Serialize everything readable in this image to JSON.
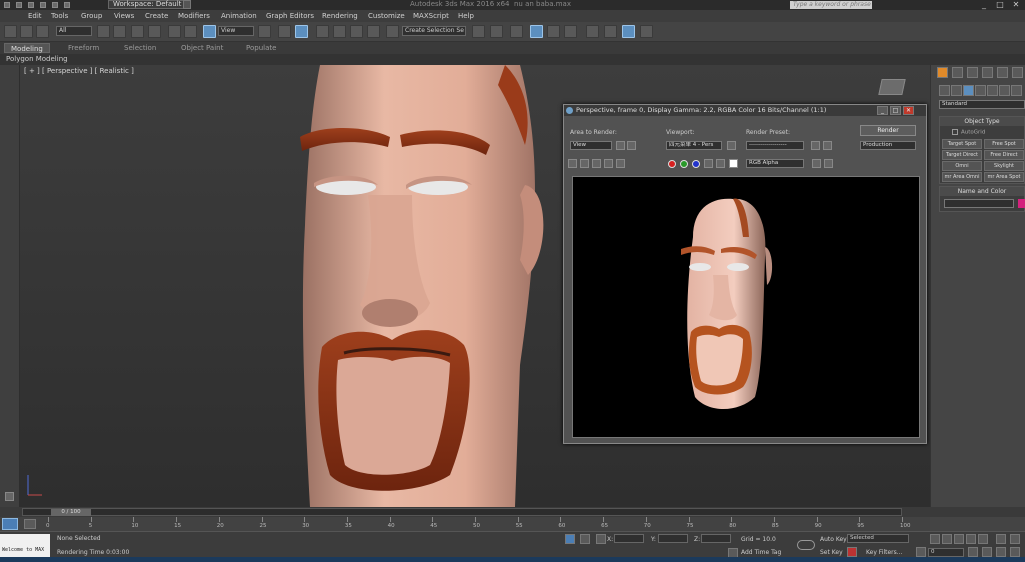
{
  "window": {
    "workspace": "Workspace: Default",
    "title": "Autodesk 3ds Max 2016 x64",
    "file": "nu an baba.max",
    "search_placeholder": "Type a keyword or phrase",
    "controls": [
      "_",
      "□",
      "✕"
    ]
  },
  "menu": [
    "Edit",
    "Tools",
    "Group",
    "Views",
    "Create",
    "Modifiers",
    "Animation",
    "Graph Editors",
    "Rendering",
    "Customize",
    "MAXScript",
    "Help"
  ],
  "toolbar": {
    "filter_value": "All",
    "ref_coord_value": "View",
    "named_selection": "Create Selection Se"
  },
  "ribbon": {
    "tabs": [
      "Modeling",
      "Freeform",
      "Selection",
      "Object Paint",
      "Populate"
    ],
    "sub_label": "Polygon Modeling"
  },
  "viewport": {
    "label": "[ + ] [ Perspective ] [ Realistic ]"
  },
  "render_window": {
    "title": "Perspective, frame 0, Display Gamma: 2.2, RGBA Color 16 Bits/Channel (1:1)",
    "area_label": "Area to Render:",
    "area_value": "View",
    "viewport_label": "Viewport:",
    "viewport_value": "四元菜单 4 - Pers",
    "preset_label": "Render Preset:",
    "preset_value": "-------------------",
    "render_button": "Render",
    "mode_value": "Production",
    "channel_value": "RGB Alpha"
  },
  "command_panel": {
    "category_value": "Standard",
    "object_type_title": "Object Type",
    "autogrid_label": "AutoGrid",
    "buttons": [
      "Target Spot",
      "Free Spot",
      "Target Direct",
      "Free Direct",
      "Omni",
      "Skylight",
      "mr Area Omni",
      "mr Area Spot"
    ],
    "name_color_title": "Name and Color",
    "swatch_color": "#d4217d"
  },
  "timeline": {
    "frame_indicator": "0 / 100",
    "ticks": [
      "0",
      "5",
      "10",
      "15",
      "20",
      "25",
      "30",
      "35",
      "40",
      "45",
      "50",
      "55",
      "60",
      "65",
      "70",
      "75",
      "80",
      "85",
      "90",
      "95",
      "100"
    ]
  },
  "status": {
    "maxscript_text": "Welcome to MAX",
    "selection": "None Selected",
    "render_time": "Rendering Time 0:03:00",
    "x_label": "X:",
    "y_label": "Y:",
    "z_label": "Z:",
    "grid": "Grid = 10.0",
    "add_time_tag": "Add Time Tag",
    "auto_key": "Auto Key",
    "auto_key_value": "Selected",
    "set_key": "Set Key",
    "key_filters": "Key Filters...",
    "frame_value": "0"
  }
}
